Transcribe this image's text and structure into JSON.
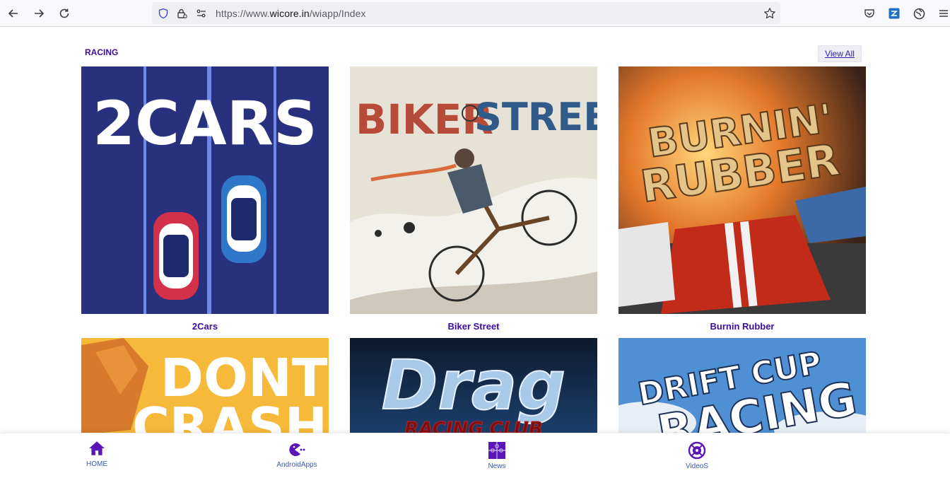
{
  "browser": {
    "url_prefix": "https://www.",
    "url_host": "wicore.in",
    "url_path": "/wiapp/Index"
  },
  "section": {
    "title": "RACING",
    "view_all": "View All"
  },
  "games": [
    {
      "title": "2Cars",
      "art_text": "2CARS"
    },
    {
      "title": "Biker Street",
      "art_text_1": "BIKER",
      "art_text_2": "STREET"
    },
    {
      "title": "Burnin Rubber",
      "art_text_1": "BURNIN'",
      "art_text_2": "RUBBER"
    },
    {
      "art_text_1": "DONT",
      "art_text_2": "CRASH"
    },
    {
      "art_text_1": "Drag",
      "art_text_2": "RACING CLUB"
    },
    {
      "art_text_1": "DRIFT CUP",
      "art_text_2": "RACING"
    }
  ],
  "bottom_nav": [
    {
      "label": "HOME",
      "icon": "home-icon"
    },
    {
      "label": "AndroidApps",
      "icon": "pacman-icon"
    },
    {
      "label": "News",
      "icon": "puzzle-icon"
    },
    {
      "label": "VideoS",
      "icon": "crosshair-icon"
    }
  ],
  "colors": {
    "accent": "#3b0d9c",
    "nav_icon": "#5b16b8"
  }
}
